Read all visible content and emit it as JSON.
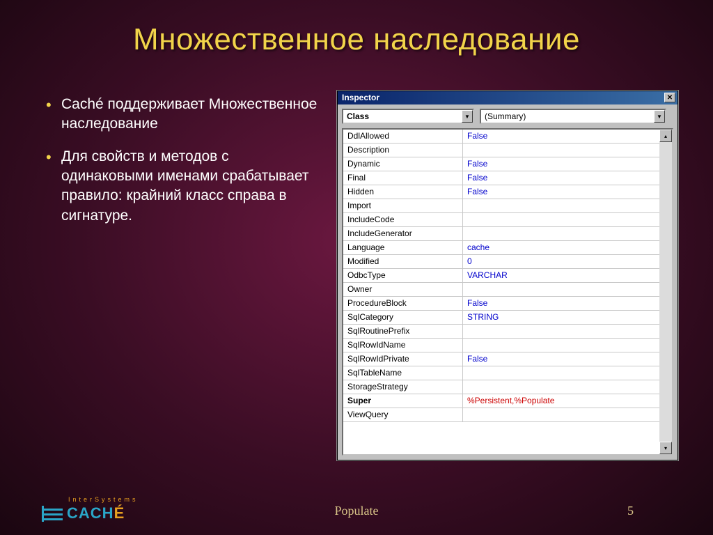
{
  "title": "Множественное наследование",
  "bullets": [
    "Caché поддерживает Множественное наследование",
    "Для свойств и методов с одинаковыми именами срабатывает правило: крайний класс справа в сигнатуре."
  ],
  "inspector": {
    "window_title": "Inspector",
    "combo1": "Class",
    "combo2": "(Summary)",
    "rows": [
      {
        "k": "DdlAllowed",
        "v": "False",
        "color": "blue"
      },
      {
        "k": "Description",
        "v": ""
      },
      {
        "k": "Dynamic",
        "v": "False",
        "color": "blue"
      },
      {
        "k": "Final",
        "v": "False",
        "color": "blue"
      },
      {
        "k": "Hidden",
        "v": "False",
        "color": "blue"
      },
      {
        "k": "Import",
        "v": ""
      },
      {
        "k": "IncludeCode",
        "v": ""
      },
      {
        "k": "IncludeGenerator",
        "v": ""
      },
      {
        "k": "Language",
        "v": "cache",
        "color": "blue"
      },
      {
        "k": "Modified",
        "v": "0",
        "color": "blue"
      },
      {
        "k": "OdbcType",
        "v": "VARCHAR",
        "color": "blue"
      },
      {
        "k": "Owner",
        "v": ""
      },
      {
        "k": "ProcedureBlock",
        "v": "False",
        "color": "blue"
      },
      {
        "k": "SqlCategory",
        "v": "STRING",
        "color": "blue"
      },
      {
        "k": "SqlRoutinePrefix",
        "v": ""
      },
      {
        "k": "SqlRowIdName",
        "v": ""
      },
      {
        "k": "SqlRowIdPrivate",
        "v": "False",
        "color": "blue"
      },
      {
        "k": "SqlTableName",
        "v": ""
      },
      {
        "k": "StorageStrategy",
        "v": ""
      },
      {
        "k": "Super",
        "v": "%Persistent,%Populate",
        "color": "red",
        "bold": true
      },
      {
        "k": "ViewQuery",
        "v": ""
      }
    ]
  },
  "footer": {
    "label": "Populate",
    "page": "5",
    "logo_top": "InterSystems",
    "logo_text": "CACHE"
  }
}
